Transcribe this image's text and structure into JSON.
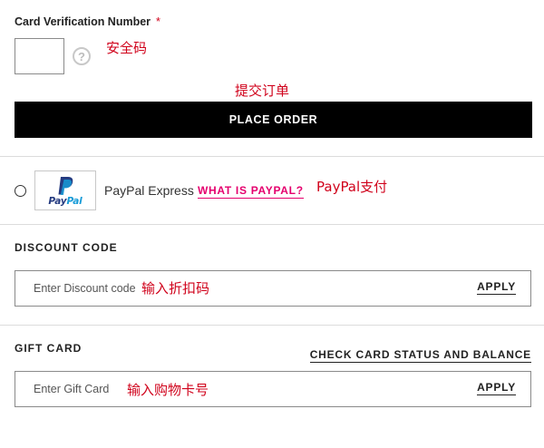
{
  "cvv": {
    "label": "Card Verification Number",
    "required_marker": "*",
    "value": "",
    "help_icon_glyph": "?",
    "annotation": "安全码"
  },
  "place_order": {
    "annotation": "提交订单",
    "label": "PLACE ORDER"
  },
  "paypal": {
    "logo_pay": "Pay",
    "logo_pal": "Pal",
    "label": "PayPal Express",
    "link": "WHAT IS PAYPAL?",
    "annotation": "PayPal支付",
    "selected": false
  },
  "discount": {
    "title": "DISCOUNT CODE",
    "placeholder": "Enter Discount code",
    "annotation": "输入折扣码",
    "apply_label": "APPLY"
  },
  "gift_card": {
    "title": "GIFT CARD",
    "check_link": "CHECK CARD STATUS AND BALANCE",
    "placeholder": "Enter Gift Card",
    "annotation": "输入购物卡号",
    "apply_label": "APPLY"
  },
  "colors": {
    "annotation_red": "#d0021b",
    "paypal_link_pink": "#e5006d",
    "button_black": "#000000",
    "paypal_dark_blue": "#253b80",
    "paypal_light_blue": "#179bd7"
  }
}
